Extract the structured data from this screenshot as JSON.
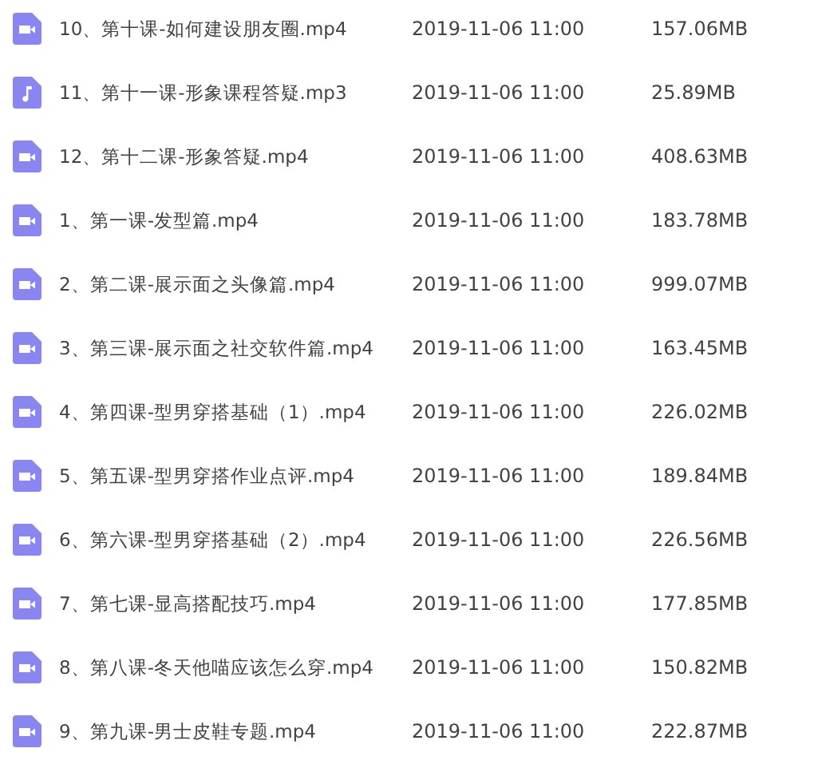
{
  "files": [
    {
      "kind": "video",
      "name": "10、第十课-如何建设朋友圈.mp4",
      "modified": "2019-11-06 11:00",
      "size": "157.06MB"
    },
    {
      "kind": "audio",
      "name": "11、第十一课-形象课程答疑.mp3",
      "modified": "2019-11-06 11:00",
      "size": "25.89MB"
    },
    {
      "kind": "video",
      "name": "12、第十二课-形象答疑.mp4",
      "modified": "2019-11-06 11:00",
      "size": "408.63MB"
    },
    {
      "kind": "video",
      "name": "1、第一课-发型篇.mp4",
      "modified": "2019-11-06 11:00",
      "size": "183.78MB"
    },
    {
      "kind": "video",
      "name": "2、第二课-展示面之头像篇.mp4",
      "modified": "2019-11-06 11:00",
      "size": "999.07MB"
    },
    {
      "kind": "video",
      "name": "3、第三课-展示面之社交软件篇.mp4",
      "modified": "2019-11-06 11:00",
      "size": "163.45MB"
    },
    {
      "kind": "video",
      "name": "4、第四课-型男穿搭基础（1）.mp4",
      "modified": "2019-11-06 11:00",
      "size": "226.02MB"
    },
    {
      "kind": "video",
      "name": "5、第五课-型男穿搭作业点评.mp4",
      "modified": "2019-11-06 11:00",
      "size": "189.84MB"
    },
    {
      "kind": "video",
      "name": "6、第六课-型男穿搭基础（2）.mp4",
      "modified": "2019-11-06 11:00",
      "size": "226.56MB"
    },
    {
      "kind": "video",
      "name": "7、第七课-显高搭配技巧.mp4",
      "modified": "2019-11-06 11:00",
      "size": "177.85MB"
    },
    {
      "kind": "video",
      "name": "8、第八课-冬天他喵应该怎么穿.mp4",
      "modified": "2019-11-06 11:00",
      "size": "150.82MB"
    },
    {
      "kind": "video",
      "name": "9、第九课-男士皮鞋专题.mp4",
      "modified": "2019-11-06 11:00",
      "size": "222.87MB"
    }
  ]
}
